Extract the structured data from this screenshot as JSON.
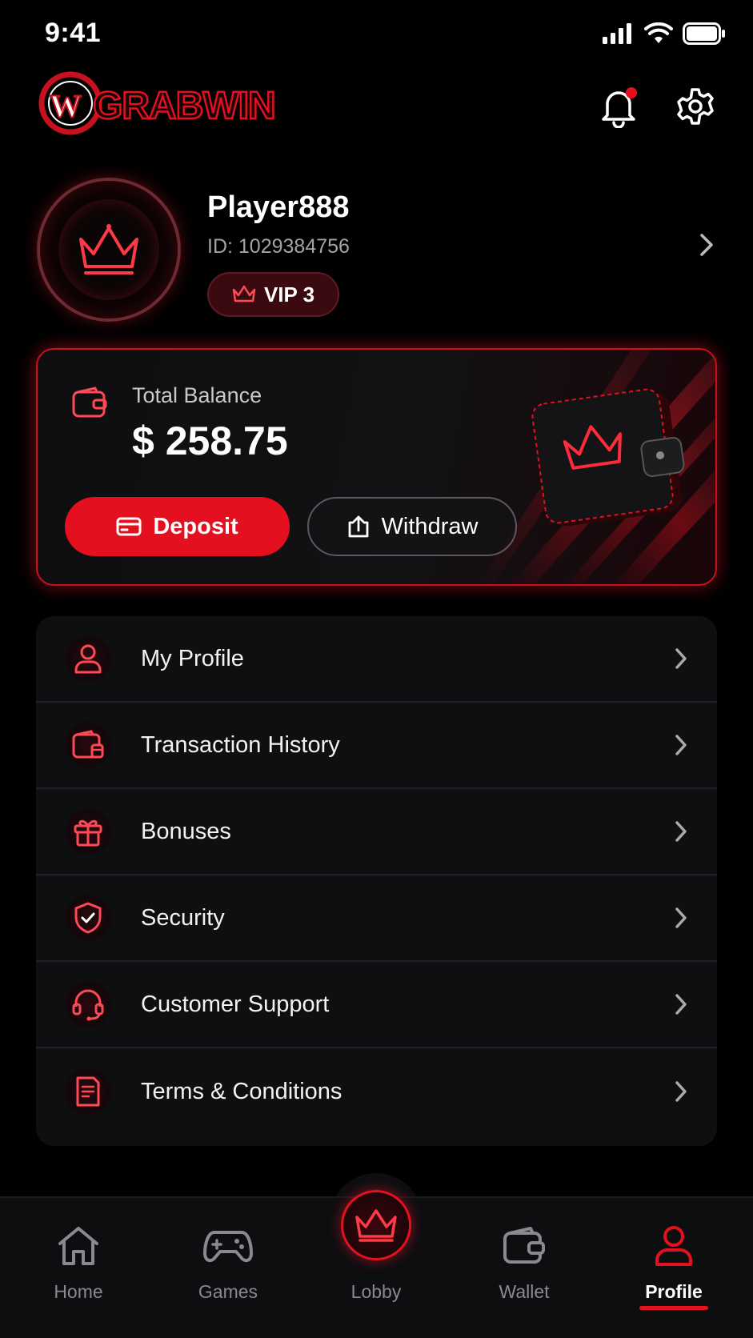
{
  "status_bar": {
    "time": "9:41"
  },
  "header": {
    "logo_text": "GRABWIN",
    "notification_dot_color": "#e5101f"
  },
  "profile": {
    "username": "Player888",
    "id_text": "ID: 1029384756",
    "vip_label": "VIP 3"
  },
  "balance": {
    "label": "Total Balance",
    "value": "$ 258.75",
    "deposit_label": "Deposit",
    "withdraw_label": "Withdraw"
  },
  "menu": {
    "items": [
      {
        "label": "My Profile",
        "icon": "user-icon"
      },
      {
        "label": "Transaction History",
        "icon": "wallet-history-icon"
      },
      {
        "label": "Bonuses",
        "icon": "gift-icon"
      },
      {
        "label": "Security",
        "icon": "shield-check-icon"
      },
      {
        "label": "Customer Support",
        "icon": "headset-icon"
      },
      {
        "label": "Terms & Conditions",
        "icon": "document-icon"
      }
    ]
  },
  "nav": {
    "items": [
      {
        "label": "Home",
        "icon": "home-icon"
      },
      {
        "label": "Games",
        "icon": "gamepad-icon"
      },
      {
        "label": "Lobby",
        "icon": "crown-icon"
      },
      {
        "label": "Wallet",
        "icon": "wallet-icon"
      },
      {
        "label": "Profile",
        "icon": "user-icon",
        "active": true
      }
    ]
  },
  "colors": {
    "accent": "#e5101f",
    "background": "#000000",
    "card": "#0e0f11"
  }
}
